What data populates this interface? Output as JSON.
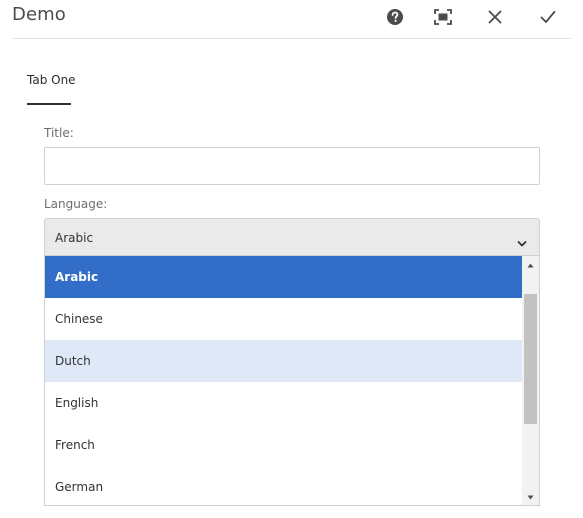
{
  "dialog": {
    "title": "Demo",
    "actions": [
      {
        "name": "help-icon"
      },
      {
        "name": "fullscreen-icon"
      },
      {
        "name": "close-icon"
      },
      {
        "name": "checkmark-icon"
      }
    ]
  },
  "tabs": [
    {
      "label": "Tab One",
      "active": true
    }
  ],
  "form": {
    "title_label": "Title:",
    "title_value": "",
    "language_label": "Language:",
    "language_value": "Arabic"
  },
  "dropdown": {
    "options": [
      {
        "label": "Arabic",
        "state": "selected"
      },
      {
        "label": "Chinese",
        "state": "normal"
      },
      {
        "label": "Dutch",
        "state": "hover"
      },
      {
        "label": "English",
        "state": "normal"
      },
      {
        "label": "French",
        "state": "normal"
      },
      {
        "label": "German",
        "state": "normal"
      }
    ]
  },
  "colors": {
    "selected": "#326ec8",
    "hover": "#dfe8f6",
    "select_bg": "#eaeaea"
  }
}
